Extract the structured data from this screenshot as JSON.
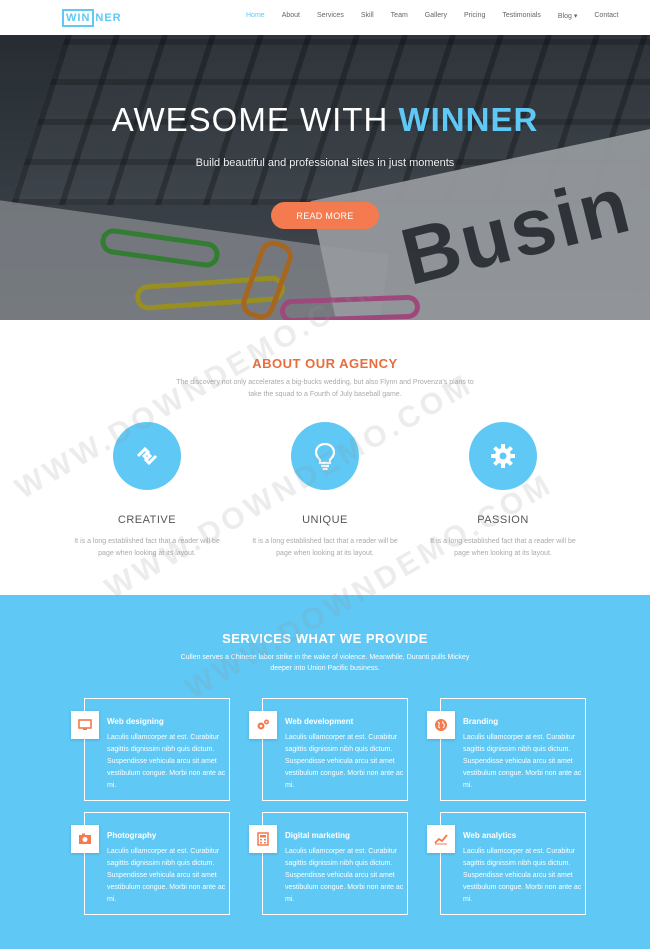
{
  "logo": {
    "box_text": "WIN",
    "rest_text": "NER"
  },
  "nav": {
    "items": [
      "Home",
      "About",
      "Services",
      "Skill",
      "Team",
      "Gallery",
      "Pricing",
      "Testimonials",
      "Blog ▾",
      "Contact"
    ],
    "active": "Home"
  },
  "hero": {
    "title_part1": "AWESOME WITH ",
    "title_part2": "WINNER",
    "subtitle": "Build beautiful and professional sites in just moments",
    "button": "READ MORE",
    "background_word": "Busin"
  },
  "about": {
    "title": "ABOUT OUR AGENCY",
    "description": "The discovery not only accelerates a big-bucks wedding, but also Flynn and Provenza's plans to take the squad to a Fourth of July baseball game.",
    "features": [
      {
        "name": "CREATIVE",
        "icon": "links-icon",
        "text": "It is a long established fact that a reader will be page when looking at its layout."
      },
      {
        "name": "UNIQUE",
        "icon": "lightbulb-icon",
        "text": "It is a long established fact that a reader will be page when looking at its layout."
      },
      {
        "name": "PASSION",
        "icon": "gear-icon",
        "text": "It is a long established fact that a reader will be page when looking at its layout."
      }
    ]
  },
  "services": {
    "title": "SERVICES WHAT WE PROVIDE",
    "description": "Cullen serves a Chinese labor strike in the wake of violence. Meanwhile, Duranti pulls Mickey deeper into Union Pacific business.",
    "cards": [
      {
        "title": "Web designing",
        "icon": "monitor-icon",
        "text": "Laculis ullamcorper at est. Curabitur sagittis dignissim nibh quis dictum. Suspendisse vehicula arcu sit amet vestibulum congue. Morbi non ante ac mi."
      },
      {
        "title": "Web development",
        "icon": "gears-icon",
        "text": "Laculis ullamcorper at est. Curabitur sagittis dignissim nibh quis dictum. Suspendisse vehicula arcu sit amet vestibulum congue. Morbi non ante ac mi."
      },
      {
        "title": "Branding",
        "icon": "globe-icon",
        "text": "Laculis ullamcorper at est. Curabitur sagittis dignissim nibh quis dictum. Suspendisse vehicula arcu sit amet vestibulum congue. Morbi non ante ac mi."
      },
      {
        "title": "Photography",
        "icon": "camera-icon",
        "text": "Laculis ullamcorper at est. Curabitur sagittis dignissim nibh quis dictum. Suspendisse vehicula arcu sit amet vestibulum congue. Morbi non ante ac mi."
      },
      {
        "title": "Digital marketing",
        "icon": "calculator-icon",
        "text": "Laculis ullamcorper at est. Curabitur sagittis dignissim nibh quis dictum. Suspendisse vehicula arcu sit amet vestibulum congue. Morbi non ante ac mi."
      },
      {
        "title": "Web analytics",
        "icon": "chart-icon",
        "text": "Laculis ullamcorper at est. Curabitur sagittis dignissim nibh quis dictum. Suspendisse vehicula arcu sit amet vestibulum congue. Morbi non ante ac mi."
      }
    ]
  },
  "watermark": "WWW.DOWNDEMO.COM",
  "colors": {
    "accent": "#5fc8f5",
    "orange": "#f47a4f",
    "title_orange": "#e86d3b"
  }
}
